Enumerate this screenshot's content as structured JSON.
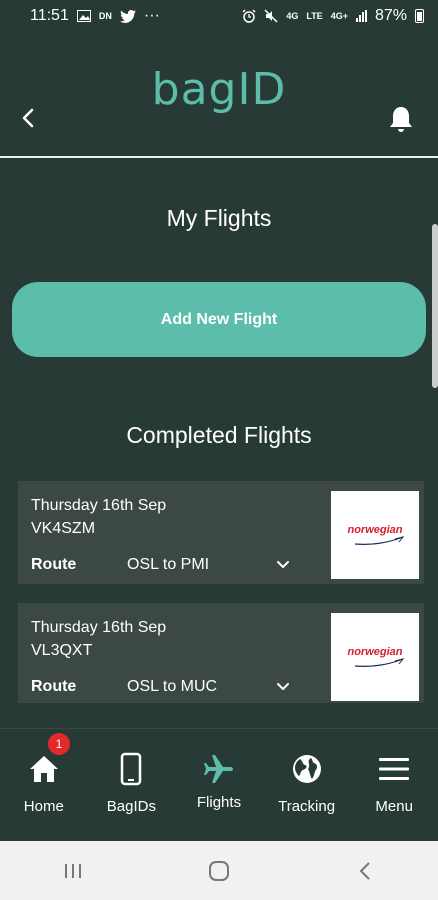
{
  "status_bar": {
    "time": "11:51",
    "left_icons": [
      "image-icon",
      "dn-icon",
      "twitter-icon",
      "more-icon"
    ],
    "dn_label": "DN",
    "more": "···",
    "network_4g": "4G",
    "network_lte": "LTE",
    "network_4g_plus": "4G+",
    "battery_percent": "87%"
  },
  "header": {
    "logo": "bagID"
  },
  "main": {
    "title": "My Flights",
    "add_button_label": "Add New Flight",
    "section_title": "Completed Flights",
    "route_label": "Route",
    "flights": [
      {
        "date": "Thursday 16th Sep",
        "code": "VK4SZM",
        "route": "OSL to PMI",
        "airline": "norwegian"
      },
      {
        "date": "Thursday 16th Sep",
        "code": "VL3QXT",
        "route": "OSL to MUC",
        "airline": "norwegian"
      }
    ]
  },
  "bottom_nav": {
    "items": [
      {
        "label": "Home",
        "icon": "home-icon",
        "badge": "1"
      },
      {
        "label": "BagIDs",
        "icon": "phone-icon"
      },
      {
        "label": "Flights",
        "icon": "airplane-icon",
        "active": true
      },
      {
        "label": "Tracking",
        "icon": "globe-icon"
      },
      {
        "label": "Menu",
        "icon": "menu-icon"
      }
    ]
  },
  "colors": {
    "background": "#283a36",
    "accent": "#5bbdaa",
    "card": "#3b4845",
    "badge": "#e32a2a",
    "airline_red": "#d61e2d"
  }
}
